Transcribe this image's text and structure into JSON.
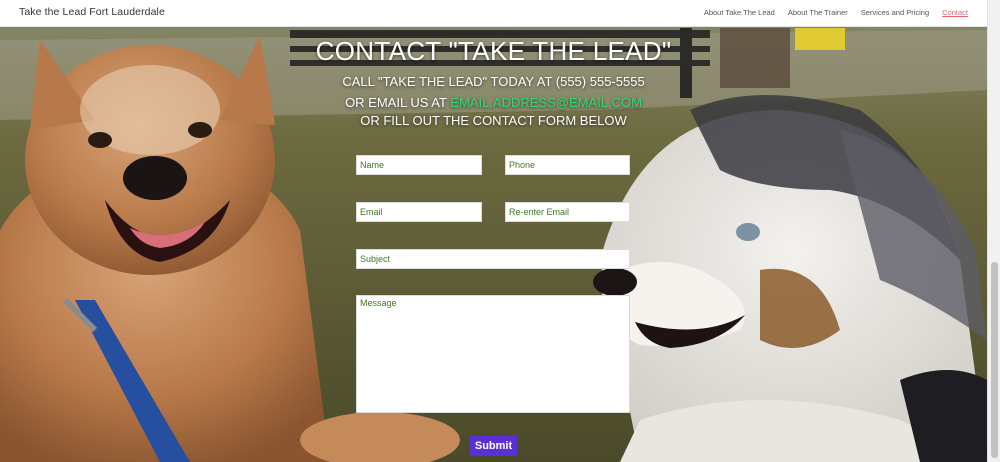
{
  "navbar": {
    "brand": "Take the Lead Fort Lauderdale",
    "links": [
      {
        "label": "About Take The Lead"
      },
      {
        "label": "About The Trainer"
      },
      {
        "label": "Services and Pricing"
      },
      {
        "label": "Contact"
      }
    ]
  },
  "contact": {
    "title": "CONTACT \"TAKE THE LEAD\"",
    "call_line": "CALL \"TAKE THE LEAD\" TODAY AT (555) 555-5555",
    "email_prefix": "OR EMAIL US AT ",
    "email": "EMAIL.ADDRESS@EMAIL.COM",
    "form_line": "OR FILL OUT THE CONTACT FORM BELOW"
  },
  "form": {
    "name_placeholder": "Name",
    "phone_placeholder": "Phone",
    "email_placeholder": "Email",
    "reenter_email_placeholder": "Re-enter Email",
    "subject_placeholder": "Subject",
    "message_placeholder": "Message",
    "submit_label": "Submit"
  },
  "colors": {
    "accent_link": "#35d86f",
    "submit_bg": "#5a2fd6",
    "active_nav": "#e06673"
  }
}
